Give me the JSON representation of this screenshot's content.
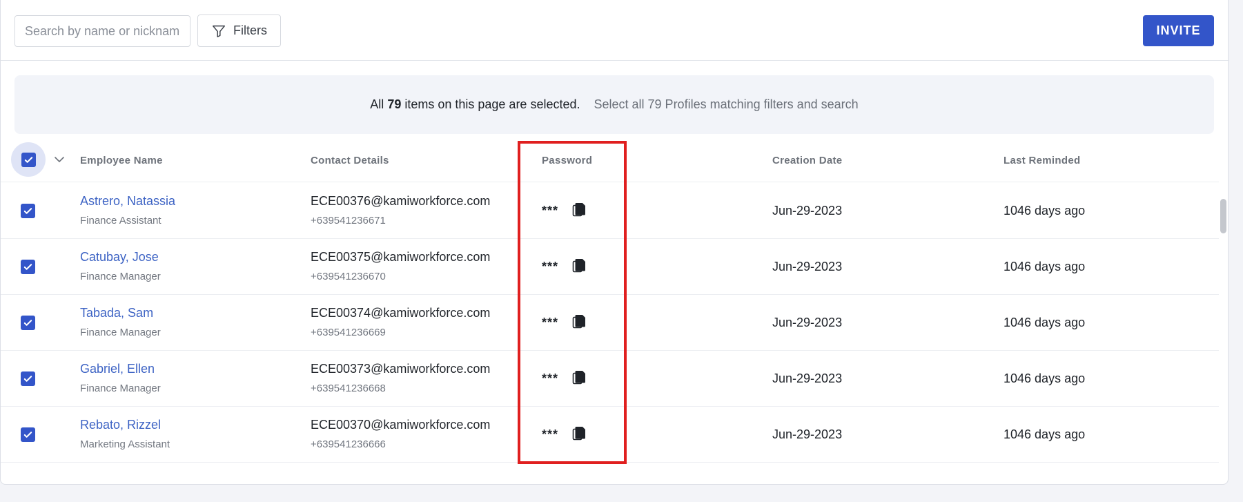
{
  "toolbar": {
    "search_placeholder": "Search by name or nickname",
    "filters_label": "Filters",
    "invite_label": "INVITE"
  },
  "banner": {
    "prefix": "All ",
    "count": "79",
    "suffix": " items on this page are selected.",
    "select_all_label": "Select all 79 Profiles matching filters and search"
  },
  "table": {
    "columns": {
      "name": "Employee Name",
      "contact": "Contact Details",
      "password": "Password",
      "created": "Creation Date",
      "reminded": "Last Reminded"
    },
    "rows": [
      {
        "name": "Astrero, Natassia",
        "role": "Finance Assistant",
        "email": "ECE00376@kamiworkforce.com",
        "phone": "+639541236671",
        "password": "***",
        "created": "Jun-29-2023",
        "reminded": "1046 days ago"
      },
      {
        "name": "Catubay, Jose",
        "role": "Finance Manager",
        "email": "ECE00375@kamiworkforce.com",
        "phone": "+639541236670",
        "password": "***",
        "created": "Jun-29-2023",
        "reminded": "1046 days ago"
      },
      {
        "name": "Tabada, Sam",
        "role": "Finance Manager",
        "email": "ECE00374@kamiworkforce.com",
        "phone": "+639541236669",
        "password": "***",
        "created": "Jun-29-2023",
        "reminded": "1046 days ago"
      },
      {
        "name": "Gabriel, Ellen",
        "role": "Finance Manager",
        "email": "ECE00373@kamiworkforce.com",
        "phone": "+639541236668",
        "password": "***",
        "created": "Jun-29-2023",
        "reminded": "1046 days ago"
      },
      {
        "name": "Rebato, Rizzel",
        "role": "Marketing Assistant",
        "email": "ECE00370@kamiworkforce.com",
        "phone": "+639541236666",
        "password": "***",
        "created": "Jun-29-2023",
        "reminded": "1046 days ago"
      }
    ]
  },
  "colors": {
    "accent": "#3355c9",
    "link": "#3d63c4",
    "highlight": "#e01f1f"
  }
}
